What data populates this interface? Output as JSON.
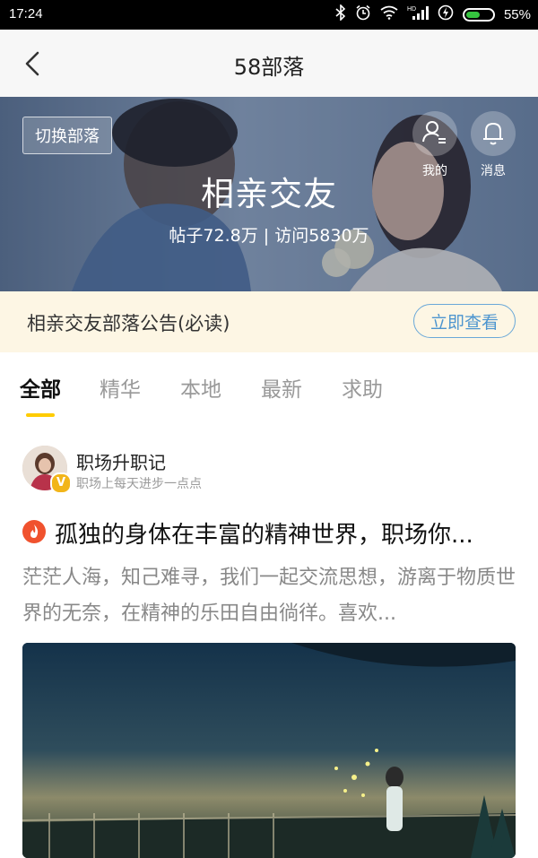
{
  "status_bar": {
    "time": "17:24",
    "battery": "55%",
    "battery_level": 0.55,
    "icons": [
      "bluetooth-icon",
      "alarm-icon",
      "wifi-icon",
      "signal-icon",
      "charging-icon",
      "battery-icon"
    ]
  },
  "nav": {
    "title": "58部落",
    "back_icon": "back-arrow-icon"
  },
  "banner": {
    "switch_label": "切换部落",
    "name": "相亲交友",
    "stats": "帖子72.8万 | 访问5830万",
    "mine_label": "我的",
    "messages_label": "消息"
  },
  "notice": {
    "text": "相亲交友部落公告(必读)",
    "button": "立即查看"
  },
  "tabs": [
    {
      "label": "全部",
      "active": true
    },
    {
      "label": "精华",
      "active": false
    },
    {
      "label": "本地",
      "active": false
    },
    {
      "label": "最新",
      "active": false
    },
    {
      "label": "求助",
      "active": false
    }
  ],
  "post": {
    "author_name": "职场升职记",
    "author_badge": "V",
    "author_desc": "职场上每天进步一点点",
    "title": "孤独的身体在丰富的精神世界，职场你...",
    "excerpt": "茫茫人海，知己难寻，我们一起交流思想，游离于物质世界的无奈，在精神的乐田自由徜徉。喜欢..."
  },
  "colors": {
    "accent_yellow": "#ffcc00",
    "notice_bg": "#fdf6e4",
    "notice_button": "#4d95cf",
    "hot": "#f0522e"
  }
}
